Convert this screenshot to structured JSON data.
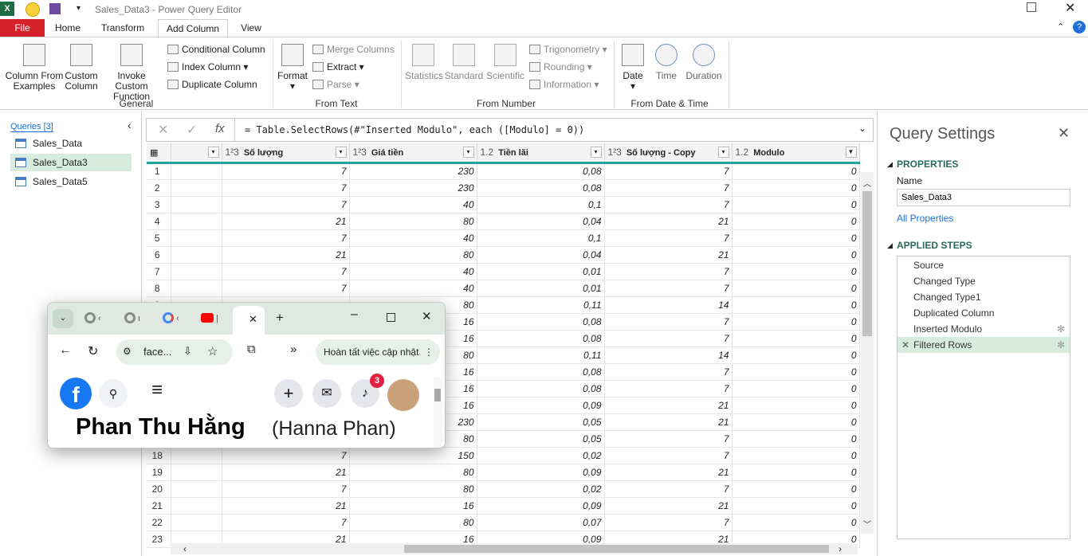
{
  "window": {
    "title": "Sales_Data3 - Power Query Editor"
  },
  "ribbon_tabs": [
    "File",
    "Home",
    "Transform",
    "Add Column",
    "View"
  ],
  "ribbon": {
    "general": {
      "label": "General",
      "buttons": [
        "Column From\nExamples",
        "Custom\nColumn",
        "Invoke Custom\nFunction"
      ],
      "small": [
        "Conditional Column",
        "Index Column",
        "Duplicate Column"
      ]
    },
    "from_text": {
      "label": "From Text",
      "format": "Format",
      "small": [
        "Merge Columns",
        "Extract",
        "Parse"
      ]
    },
    "from_number": {
      "label": "From Number",
      "buttons": [
        "Statistics",
        "Standard",
        "Scientific"
      ],
      "small": [
        "Trigonometry",
        "Rounding",
        "Information"
      ]
    },
    "from_date": {
      "label": "From Date & Time",
      "buttons": [
        "Date",
        "Time",
        "Duration"
      ]
    }
  },
  "queries": {
    "header": "Queries [3]",
    "items": [
      "Sales_Data",
      "Sales_Data3",
      "Sales_Data5"
    ],
    "selected": 1
  },
  "formula": "= Table.SelectRows(#\"Inserted Modulo\", each ([Modulo] = 0))",
  "grid": {
    "columns": [
      {
        "type": "",
        "name": ""
      },
      {
        "type": "1²3",
        "name": "Số lượng"
      },
      {
        "type": "1²3",
        "name": "Giá tiền"
      },
      {
        "type": "1.2",
        "name": "Tiền lãi"
      },
      {
        "type": "1²3",
        "name": "Số lượng - Copy"
      },
      {
        "type": "1.2",
        "name": "Modulo"
      }
    ],
    "rows": [
      [
        "7",
        "230",
        "0,08",
        "7",
        "0"
      ],
      [
        "7",
        "230",
        "0,08",
        "7",
        "0"
      ],
      [
        "7",
        "40",
        "0,1",
        "7",
        "0"
      ],
      [
        "21",
        "80",
        "0,04",
        "21",
        "0"
      ],
      [
        "7",
        "40",
        "0,1",
        "7",
        "0"
      ],
      [
        "21",
        "80",
        "0,04",
        "21",
        "0"
      ],
      [
        "7",
        "40",
        "0,01",
        "7",
        "0"
      ],
      [
        "7",
        "40",
        "0,01",
        "7",
        "0"
      ],
      [
        "",
        "80",
        "0,11",
        "14",
        "0"
      ],
      [
        "",
        "16",
        "0,08",
        "7",
        "0"
      ],
      [
        "",
        "16",
        "0,08",
        "7",
        "0"
      ],
      [
        "",
        "80",
        "0,11",
        "14",
        "0"
      ],
      [
        "",
        "16",
        "0,08",
        "7",
        "0"
      ],
      [
        "",
        "16",
        "0,08",
        "7",
        "0"
      ],
      [
        "",
        "16",
        "0,09",
        "21",
        "0"
      ],
      [
        "",
        "230",
        "0,05",
        "21",
        "0"
      ],
      [
        "",
        "80",
        "0,05",
        "7",
        "0"
      ],
      [
        "7",
        "150",
        "0,02",
        "7",
        "0"
      ],
      [
        "21",
        "80",
        "0,09",
        "21",
        "0"
      ],
      [
        "7",
        "80",
        "0,02",
        "7",
        "0"
      ],
      [
        "21",
        "16",
        "0,09",
        "21",
        "0"
      ],
      [
        "7",
        "80",
        "0,07",
        "7",
        "0"
      ],
      [
        "21",
        "16",
        "0,09",
        "21",
        "0"
      ]
    ]
  },
  "settings": {
    "title": "Query Settings",
    "properties": "PROPERTIES",
    "name_label": "Name",
    "name_value": "Sales_Data3",
    "all_props": "All Properties",
    "applied": "APPLIED STEPS",
    "steps": [
      "Source",
      "Changed Type",
      "Changed Type1",
      "Duplicated Column",
      "Inserted Modulo",
      "Filtered Rows"
    ]
  },
  "chrome": {
    "address": "face...",
    "update_label": "Hoàn tất việc cập nhật",
    "profile_name": "Phan Thu Hằng",
    "profile_alt": "(Hanna Phan)",
    "notifications": "3"
  }
}
